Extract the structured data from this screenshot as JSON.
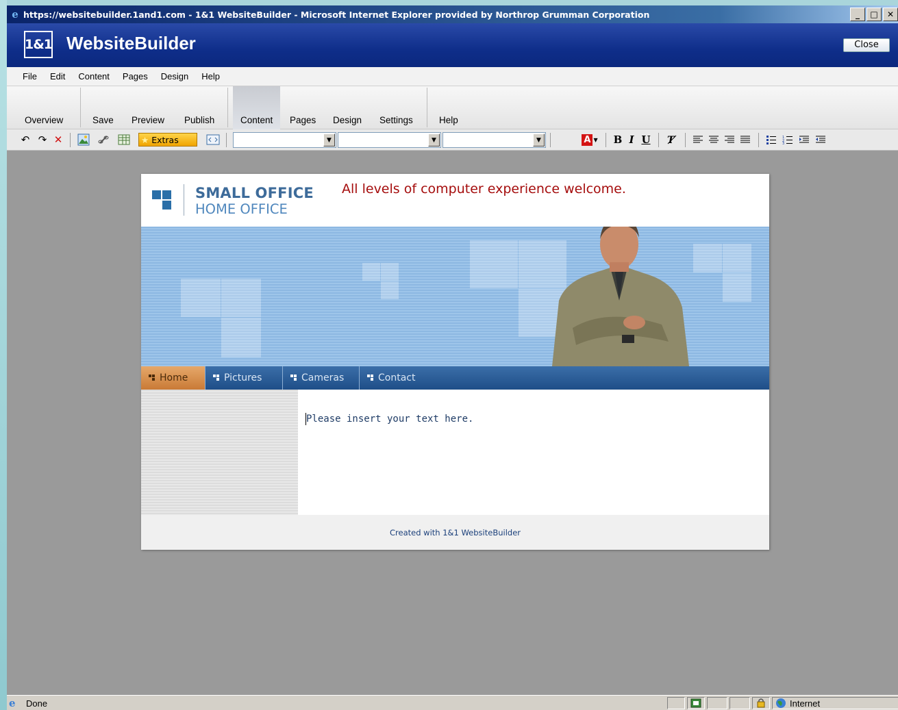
{
  "window": {
    "title": "https://websitebuilder.1and1.com - 1&1 WebsiteBuilder - Microsoft Internet Explorer provided by Northrop Grumman Corporation",
    "minimize": "_",
    "maximize": "□",
    "close": "✕"
  },
  "app": {
    "logo": "1&1",
    "title": "WebsiteBuilder",
    "close_label": "Close"
  },
  "menu": [
    "File",
    "Edit",
    "Content",
    "Pages",
    "Design",
    "Help"
  ],
  "tabs": {
    "overview": "Overview",
    "save": "Save",
    "preview": "Preview",
    "publish": "Publish",
    "content": "Content",
    "pages": "Pages",
    "design": "Design",
    "settings": "Settings",
    "help": "Help",
    "active": "Content"
  },
  "toolbar": {
    "extras_label": "Extras",
    "bold": "B",
    "italic": "I",
    "underline": "U",
    "font_color_letter": "A",
    "font_select": "",
    "size_select": "",
    "style_select": ""
  },
  "site": {
    "logo_line1": "SMALL OFFICE",
    "logo_line2": "HOME OFFICE",
    "slogan": "All levels of computer experience welcome.",
    "nav": [
      "Home",
      "Pictures",
      "Cameras",
      "Contact"
    ],
    "body_text": "Please insert your text here.",
    "footer": "Created with 1&1 WebsiteBuilder"
  },
  "status": {
    "text": "Done",
    "zone": "Internet"
  },
  "colors": {
    "header_blue": "#0f2e8a",
    "slogan_red": "#a50d0d",
    "nav_active": "#c97a36",
    "logo_blue": "#3d6b9a"
  }
}
